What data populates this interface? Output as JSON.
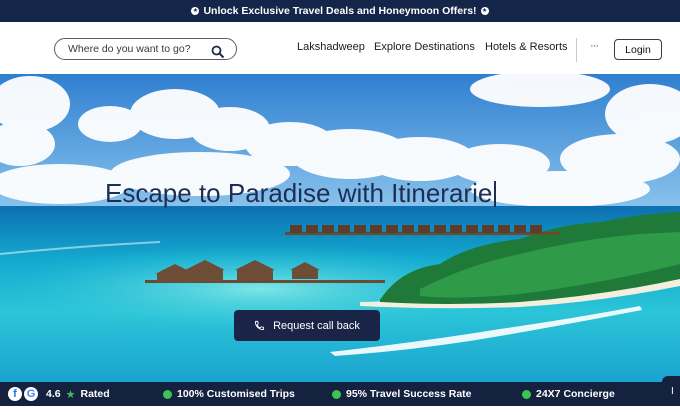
{
  "announcement": {
    "text": "Unlock Exclusive Travel Deals and Honeymoon Offers!"
  },
  "search": {
    "placeholder": "Where do you want to go?"
  },
  "nav": {
    "links": [
      "Lakshadweep",
      "Explore Destinations",
      "Hotels & Resorts"
    ],
    "more_label": "···",
    "login_label": "Login"
  },
  "hero": {
    "headline": "Escape to Paradise with Itinerarie",
    "cta_label": "Request call back"
  },
  "trust_bar": {
    "rating_value": "4.6",
    "rating_label": "Rated",
    "items": [
      "100% Customised Trips",
      "95% Travel Success Rate",
      "24X7 Concierge"
    ],
    "side_tab_label": "I"
  },
  "colors": {
    "navy": "#15254a",
    "accent_green": "#3fc255",
    "sky": "#3f8fd6",
    "sea": "#1fb8d6"
  },
  "icons": [
    "gift-icon",
    "search-icon",
    "phone-icon",
    "facebook-icon",
    "google-icon",
    "star-icon",
    "check-circle-icon"
  ]
}
